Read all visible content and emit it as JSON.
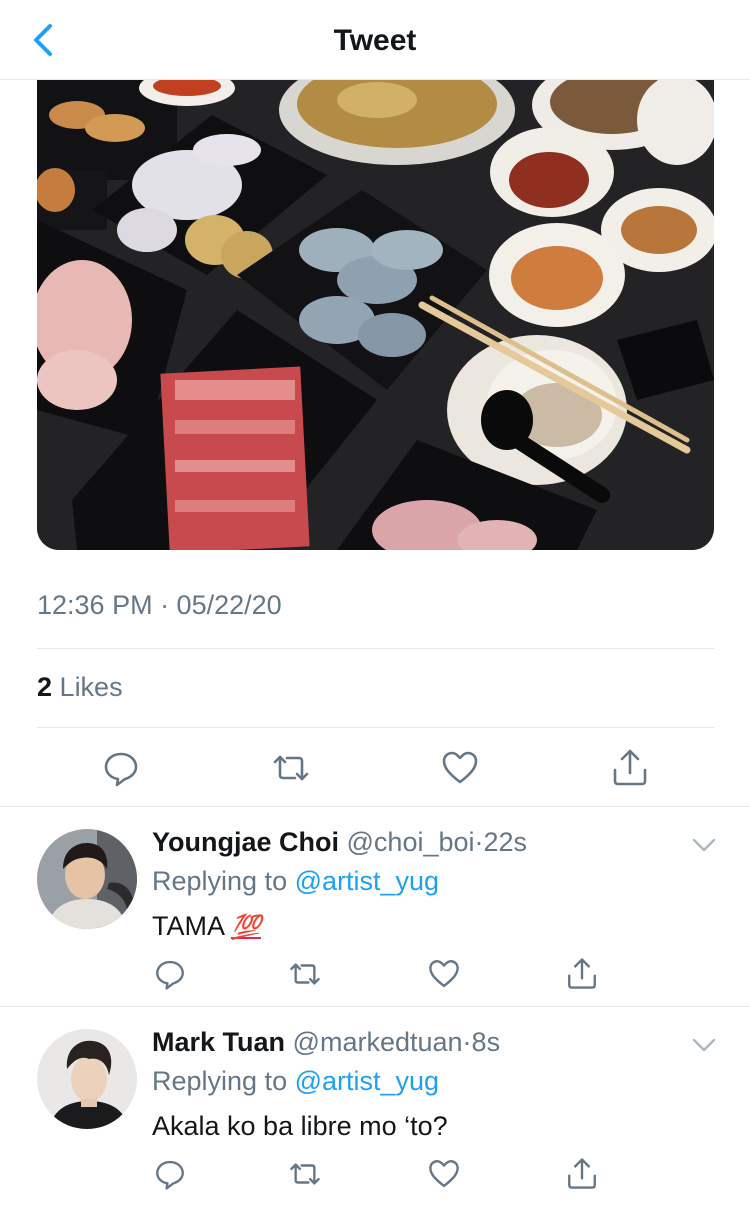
{
  "header": {
    "title": "Tweet",
    "back_icon": "chevron-left-icon"
  },
  "tweet": {
    "media_description_icon": "photo-image",
    "timestamp": "12:36 PM · 05/22/20",
    "likes_count": "2",
    "likes_label": "Likes",
    "actions": [
      "reply-icon",
      "retweet-icon",
      "like-icon",
      "share-icon"
    ]
  },
  "replies": [
    {
      "name": "Youngjae Choi",
      "handle": "@choi_boi",
      "dot": "·",
      "time": "22s",
      "replying_prefix": "Replying to",
      "replying_to": "@artist_yug",
      "text": "TAMA",
      "emoji": "💯"
    },
    {
      "name": "Mark Tuan",
      "handle": "@markedtuan",
      "dot": "·",
      "time": "8s",
      "replying_prefix": "Replying to",
      "replying_to": "@artist_yug",
      "text": "Akala ko ba libre mo ‘to?"
    }
  ],
  "colors": {
    "accent": "#1da1f2",
    "secondary_text": "#657786",
    "divider": "#e1e8ed",
    "icon": "#657786"
  }
}
